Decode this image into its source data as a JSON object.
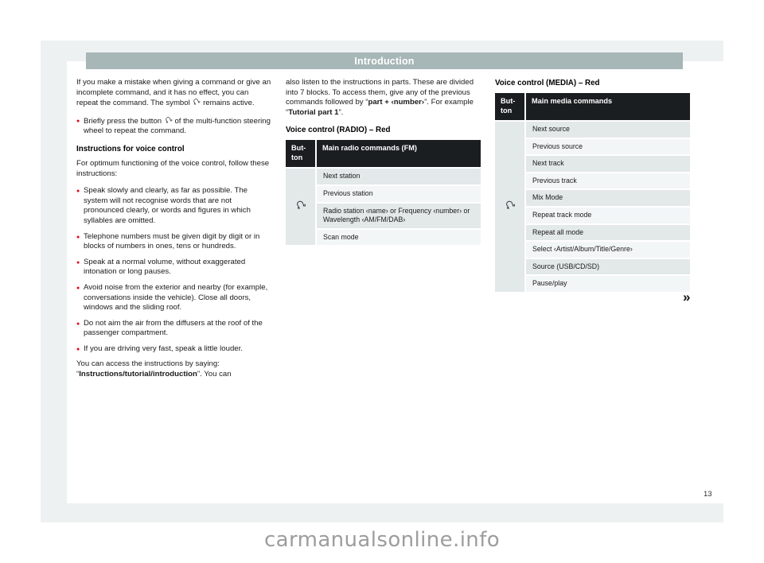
{
  "header": {
    "title": "Introduction"
  },
  "page_number": "13",
  "watermark": "carmanualsonline.info",
  "next_page_marker": "»",
  "icons": {
    "voice_control": "voice-control-icon"
  },
  "left_column": {
    "paragraph_1_part1": "If you make a mistake when giving a command or give an incomplete command, and it has no effect, you can repeat the command. The symbol ",
    "paragraph_1_part2": " remains active.",
    "bullet_1_part1": "Briefly press the button ",
    "bullet_1_part2": " of the multi-function steering wheel to repeat the command.",
    "heading_instructions": "Instructions for voice control",
    "paragraph_2": "For optimum functioning of the voice control, follow these instructions:",
    "bullet_2": "Speak slowly and clearly, as far as possible. The system will not recognise words that are not pronounced clearly, or words and figures in which syllables are omitted.",
    "bullet_3": "Telephone numbers must be given digit by digit or in blocks of numbers in ones, tens or hundreds.",
    "bullet_4": "Speak at a normal volume, without exaggerated intonation or long pauses.",
    "bullet_5": "Avoid noise from the exterior and nearby (for example, conversations inside the vehicle). Close all doors, windows and the sliding roof.",
    "bullet_6": "Do not aim the air from the diffusers at the roof of the passenger compartment.",
    "bullet_7": "If you are driving very fast, speak a little louder.",
    "paragraph_3_part1": "You can access the instructions by saying: “",
    "paragraph_3_bold": "Instructions/tutorial/introduction",
    "paragraph_3_part2": "”. You can"
  },
  "middle_column": {
    "paragraph_1_part1": "also listen to the instructions in parts. These are divided into 7 blocks. To access them, give any of the previous commands followed by “",
    "paragraph_1_bold1": "part + ‹number›",
    "paragraph_1_part2": "”. For example “",
    "paragraph_1_bold2": "Tutorial part 1",
    "paragraph_1_part3": "”.",
    "heading_radio": "Voice control (RADIO) – Red",
    "radio_table": {
      "header_button": "But-\nton",
      "header_commands": "Main radio commands (FM)",
      "rows": [
        "Next station",
        "Previous station",
        "Radio station ‹name› or Frequency ‹number› or Wavelength ‹AM/FM/DAB›",
        "Scan mode"
      ]
    }
  },
  "right_column": {
    "heading_media": "Voice control (MEDIA) – Red",
    "media_table": {
      "header_button": "But-\nton",
      "header_commands": "Main media commands",
      "rows": [
        "Next source",
        "Previous source",
        "Next track",
        "Previous track",
        "Mix Mode",
        "Repeat track mode",
        "Repeat all mode",
        "Select ‹Artist/Album/Title/Genre›",
        "Source (USB/CD/SD)",
        "Pause/play"
      ]
    }
  },
  "colors": {
    "header_bar": "#a7b6b6",
    "bullet_red": "#e2001a",
    "table_header_bg": "#1b1e20",
    "row_odd": "#e3e8e9",
    "row_even": "#f3f6f7",
    "page_band": "#eef1f2"
  }
}
